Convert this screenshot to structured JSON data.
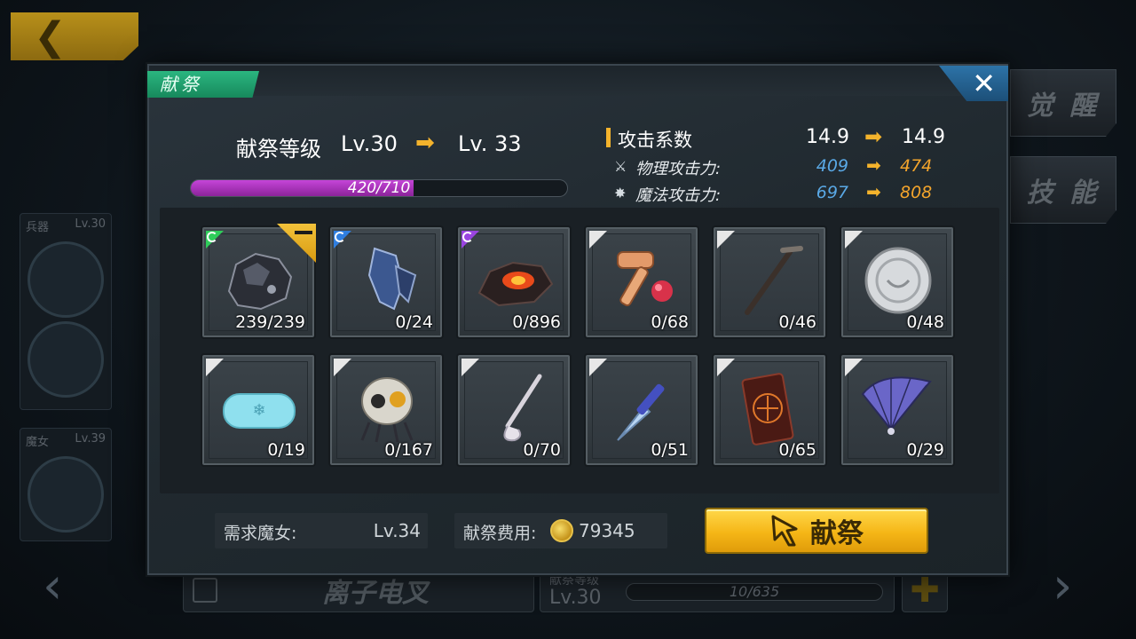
{
  "background": {
    "awaken_label": "觉 醒",
    "skill_label": "技 能",
    "weapon_card": {
      "label": "兵器",
      "level": "Lv.30"
    },
    "witch_card": {
      "label": "魔女",
      "level": "Lv.39"
    },
    "weapon_name": "离子电叉",
    "sacrifice_level_label": "献祭等级",
    "sacrifice_level": "Lv.30",
    "sacrifice_progress": "10/635",
    "plus_symbol": "✚"
  },
  "modal": {
    "title": "献祭",
    "close_symbol": "✕",
    "level": {
      "label": "献祭等级",
      "from": "Lv.30",
      "to": "Lv. 33",
      "arrow": "➡"
    },
    "progress": {
      "text": "420/710",
      "fraction": 0.5915
    },
    "stats": {
      "header": "攻击系数",
      "header_from": "14.9",
      "header_to": "14.9",
      "rows": [
        {
          "label": "物理攻击力:",
          "from": "409",
          "to": "474",
          "icon": "sword-icon"
        },
        {
          "label": "魔法攻击力:",
          "from": "697",
          "to": "808",
          "icon": "wand-icon"
        }
      ]
    },
    "materials": [
      {
        "count": "239/239",
        "rarity": "green",
        "icon": "ore-icon",
        "removable": true
      },
      {
        "count": "0/24",
        "rarity": "blue",
        "icon": "crystal-icon",
        "removable": false
      },
      {
        "count": "0/896",
        "rarity": "purple",
        "icon": "lava-rock-icon",
        "removable": false
      },
      {
        "count": "0/68",
        "rarity": "white",
        "icon": "kendama-icon",
        "removable": false
      },
      {
        "count": "0/46",
        "rarity": "white",
        "icon": "cane-icon",
        "removable": false
      },
      {
        "count": "0/48",
        "rarity": "white",
        "icon": "coin-icon",
        "removable": false
      },
      {
        "count": "0/19",
        "rarity": "white",
        "icon": "soap-icon",
        "removable": false
      },
      {
        "count": "0/167",
        "rarity": "white",
        "icon": "skull-icon",
        "removable": false
      },
      {
        "count": "0/70",
        "rarity": "white",
        "icon": "pipe-icon",
        "removable": false
      },
      {
        "count": "0/51",
        "rarity": "white",
        "icon": "knife-icon",
        "removable": false
      },
      {
        "count": "0/65",
        "rarity": "white",
        "icon": "talisman-icon",
        "removable": false
      },
      {
        "count": "0/29",
        "rarity": "white",
        "icon": "fan-icon",
        "removable": false
      }
    ],
    "requirement": {
      "label": "需求魔女:",
      "value": "Lv.34"
    },
    "cost": {
      "label": "献祭费用:",
      "value": "79345"
    },
    "sacrifice_button": "献祭"
  }
}
